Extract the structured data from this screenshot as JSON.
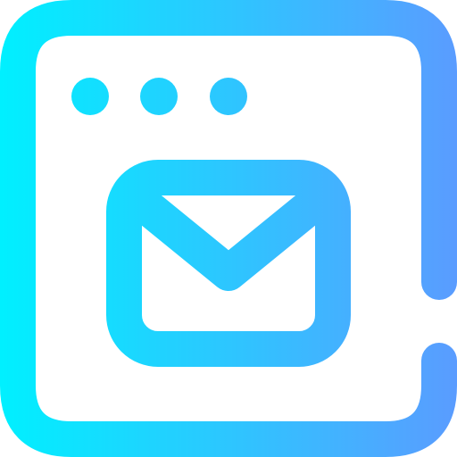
{
  "icon": {
    "name": "browser-mail-icon",
    "gradient": {
      "start_color": "#00F0FF",
      "end_color": "#5A9CFF"
    },
    "window_dots": 3
  }
}
